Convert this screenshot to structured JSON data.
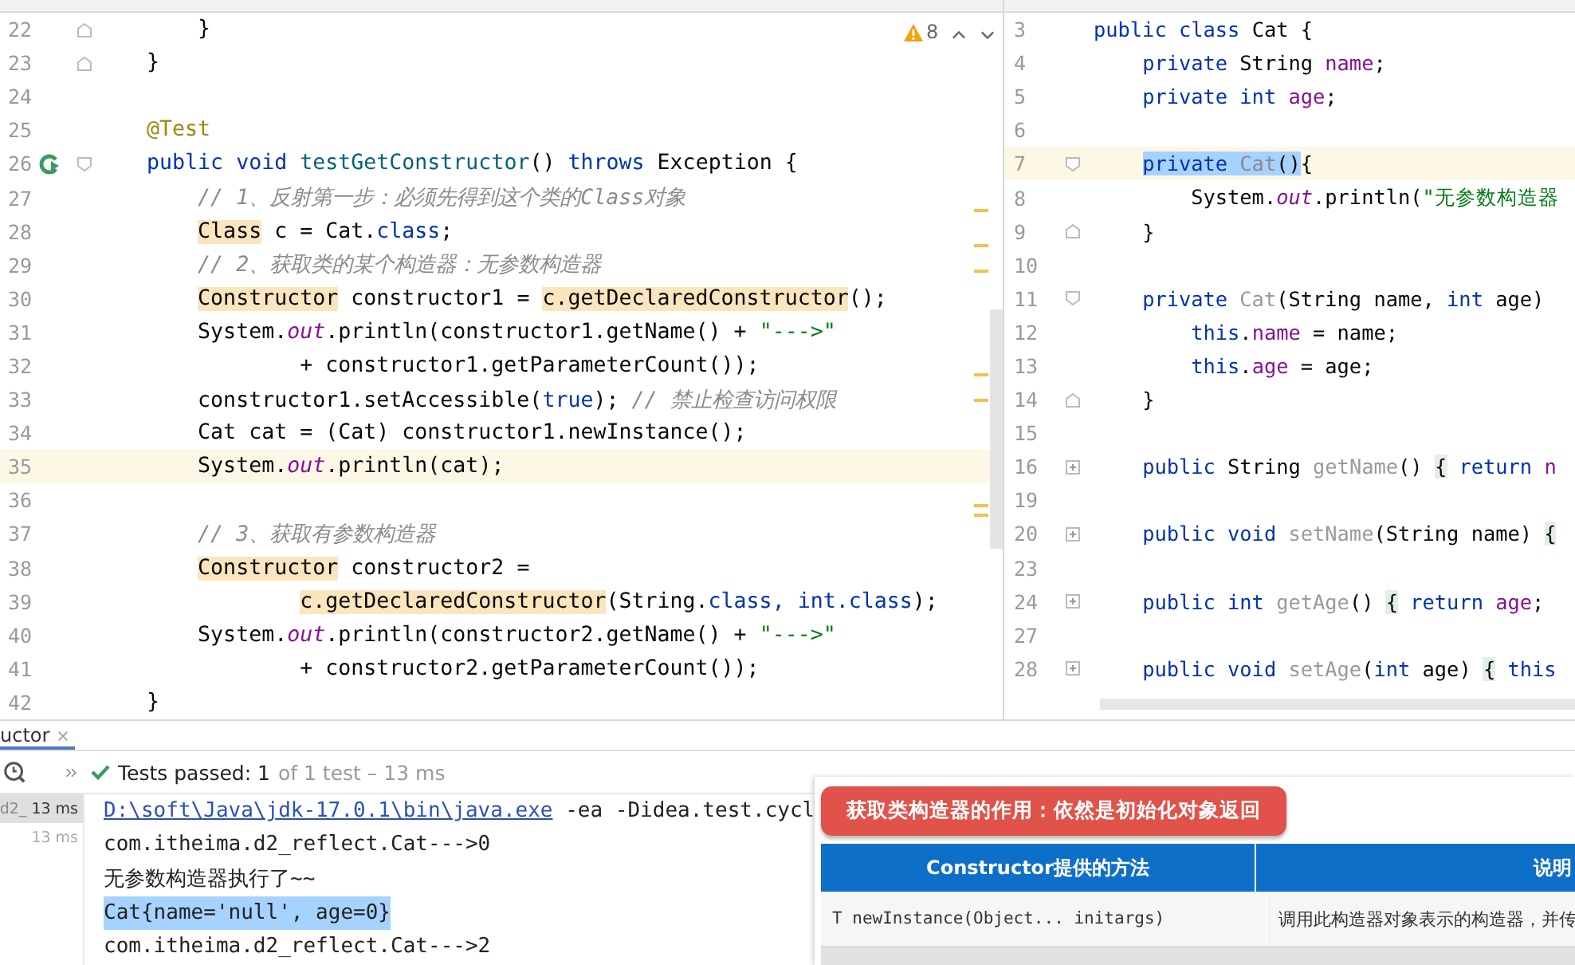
{
  "left_editor": {
    "warnings": "8",
    "lines": [
      {
        "no": "22",
        "current": false,
        "gutter": {
          "kind": "foldend"
        },
        "tokens": [
          {
            "kind": "p",
            "text": "        }"
          }
        ]
      },
      {
        "no": "23",
        "current": false,
        "gutter": {
          "kind": "foldend"
        },
        "tokens": [
          {
            "kind": "p",
            "text": "    }"
          }
        ]
      },
      {
        "no": "24",
        "current": false
      },
      {
        "no": "25",
        "current": false,
        "tokens": [
          {
            "kind": "a",
            "text": "    @Test"
          }
        ]
      },
      {
        "no": "26",
        "current": false,
        "gutter": {
          "kind": "run"
        },
        "tokens": [
          {
            "kind": "k",
            "text": "    public void "
          },
          {
            "kind": "m",
            "text": "testGetConstructor"
          },
          {
            "kind": "p",
            "text": "() "
          },
          {
            "kind": "k",
            "text": "throws "
          },
          {
            "kind": "p",
            "text": "Exception {"
          }
        ]
      },
      {
        "no": "27",
        "current": false,
        "tokens": [
          {
            "kind": "c",
            "text": "        // 1、反射第一步：必须先得到这个类的Class对象"
          }
        ]
      },
      {
        "no": "28",
        "current": false,
        "tokens": [
          {
            "kind": "h",
            "text": "        Class"
          },
          {
            "kind": "p",
            "text": " c = Cat."
          },
          {
            "kind": "k",
            "text": "class"
          },
          {
            "kind": "p",
            "text": ";"
          }
        ]
      },
      {
        "no": "29",
        "current": false,
        "tokens": [
          {
            "kind": "c",
            "text": "        // 2、获取类的某个构造器：无参数构造器"
          }
        ]
      },
      {
        "no": "30",
        "current": false,
        "tokens": [
          {
            "kind": "h",
            "text": "        Constructor"
          },
          {
            "kind": "p",
            "text": " constructor1 = "
          },
          {
            "kind": "h",
            "text": "c.getDeclaredConstructor"
          },
          {
            "kind": "p",
            "text": "();"
          }
        ]
      },
      {
        "no": "31",
        "current": false,
        "tokens": [
          {
            "kind": "p",
            "text": "        System."
          },
          {
            "kind": "f",
            "text": "out"
          },
          {
            "kind": "p",
            "text": ".println(constructor1.getName() + "
          },
          {
            "kind": "s",
            "text": "\"--->\""
          }
        ]
      },
      {
        "no": "32",
        "current": false,
        "tokens": [
          {
            "kind": "p",
            "text": "                + constructor1.getParameterCount());"
          }
        ]
      },
      {
        "no": "33",
        "current": false,
        "tokens": [
          {
            "kind": "p",
            "text": "        constructor1.setAccessible("
          },
          {
            "kind": "k",
            "text": "true"
          },
          {
            "kind": "p",
            "text": "); "
          },
          {
            "kind": "c",
            "text": "// 禁止检查访问权限"
          }
        ]
      },
      {
        "no": "34",
        "current": false,
        "tokens": [
          {
            "kind": "p",
            "text": "        Cat cat = (Cat) constructor1.newInstance();"
          }
        ]
      },
      {
        "no": "35",
        "current": true,
        "tokens": [
          {
            "kind": "p",
            "text": "        System."
          },
          {
            "kind": "f",
            "text": "out"
          },
          {
            "kind": "p",
            "text": ".println(cat);"
          }
        ]
      },
      {
        "no": "36",
        "current": false
      },
      {
        "no": "37",
        "current": false,
        "tokens": [
          {
            "kind": "c",
            "text": "        // 3、获取有参数构造器"
          }
        ]
      },
      {
        "no": "38",
        "current": false,
        "tokens": [
          {
            "kind": "h",
            "text": "        Constructor"
          },
          {
            "kind": "p",
            "text": " constructor2 ="
          }
        ]
      },
      {
        "no": "39",
        "current": false,
        "tokens": [
          {
            "kind": "h",
            "text": "                c.getDeclaredConstructor"
          },
          {
            "kind": "p",
            "text": "(String."
          },
          {
            "kind": "k",
            "text": "class"
          },
          {
            "kind": "k",
            "text": ", int.class"
          },
          {
            "kind": "p",
            "text": ");"
          }
        ]
      },
      {
        "no": "40",
        "current": false,
        "tokens": [
          {
            "kind": "p",
            "text": "        System."
          },
          {
            "kind": "f",
            "text": "out"
          },
          {
            "kind": "p",
            "text": ".println(constructor2.getName() + "
          },
          {
            "kind": "s",
            "text": "\"--->\""
          }
        ]
      },
      {
        "no": "41",
        "current": false,
        "tokens": [
          {
            "kind": "p",
            "text": "                + constructor2.getParameterCount());"
          }
        ]
      },
      {
        "no": "42",
        "current": false,
        "tokens": [
          {
            "kind": "p",
            "text": "    }"
          }
        ]
      }
    ]
  },
  "right_editor": {
    "lines": [
      {
        "no": "3",
        "current": false,
        "tokens": [
          {
            "kind": "k",
            "text": "public class "
          },
          {
            "kind": "p",
            "text": "Cat {"
          }
        ]
      },
      {
        "no": "4",
        "current": false,
        "tokens": [
          {
            "kind": "k",
            "text": "    private "
          },
          {
            "kind": "p",
            "text": "String "
          },
          {
            "kind": "v",
            "text": "name"
          },
          {
            "kind": "p",
            "text": ";"
          }
        ]
      },
      {
        "no": "5",
        "current": false,
        "tokens": [
          {
            "kind": "k",
            "text": "    private int "
          },
          {
            "kind": "v",
            "text": "age"
          },
          {
            "kind": "p",
            "text": ";"
          }
        ]
      },
      {
        "no": "6",
        "current": false
      },
      {
        "no": "7",
        "current": true,
        "gutter": {
          "kind": "fold"
        },
        "tokens": [
          {
            "kind": "xk",
            "text": "    private "
          },
          {
            "kind": "xg",
            "text": "Cat"
          },
          {
            "kind": "xp",
            "text": "()"
          },
          {
            "kind": "p",
            "text": "{"
          }
        ]
      },
      {
        "no": "8",
        "current": false,
        "tokens": [
          {
            "kind": "p",
            "text": "        System."
          },
          {
            "kind": "f",
            "text": "out"
          },
          {
            "kind": "p",
            "text": ".println("
          },
          {
            "kind": "s",
            "text": "\"无参数构造器"
          }
        ]
      },
      {
        "no": "9",
        "current": false,
        "gutter": {
          "kind": "foldend"
        },
        "tokens": [
          {
            "kind": "p",
            "text": "    }"
          }
        ]
      },
      {
        "no": "10",
        "current": false
      },
      {
        "no": "11",
        "current": false,
        "gutter": {
          "kind": "fold"
        },
        "tokens": [
          {
            "kind": "k",
            "text": "    private "
          },
          {
            "kind": "g",
            "text": "Cat"
          },
          {
            "kind": "p",
            "text": "(String name, "
          },
          {
            "kind": "k",
            "text": "int"
          },
          {
            "kind": "p",
            "text": " age)"
          }
        ]
      },
      {
        "no": "12",
        "current": false,
        "tokens": [
          {
            "kind": "k",
            "text": "        this"
          },
          {
            "kind": "p",
            "text": "."
          },
          {
            "kind": "v",
            "text": "name"
          },
          {
            "kind": "p",
            "text": " = name;"
          }
        ]
      },
      {
        "no": "13",
        "current": false,
        "tokens": [
          {
            "kind": "k",
            "text": "        this"
          },
          {
            "kind": "p",
            "text": "."
          },
          {
            "kind": "v",
            "text": "age"
          },
          {
            "kind": "p",
            "text": " = age;"
          }
        ]
      },
      {
        "no": "14",
        "current": false,
        "gutter": {
          "kind": "foldend"
        },
        "tokens": [
          {
            "kind": "p",
            "text": "    }"
          }
        ]
      },
      {
        "no": "15",
        "current": false
      },
      {
        "no": "16",
        "current": false,
        "gutter": {
          "kind": "plus"
        },
        "tokens": [
          {
            "kind": "k",
            "text": "    public "
          },
          {
            "kind": "p",
            "text": "String "
          },
          {
            "kind": "g",
            "text": "getName"
          },
          {
            "kind": "p",
            "text": "() "
          },
          {
            "kind": "b",
            "text": "{"
          },
          {
            "kind": "k",
            "text": " return "
          },
          {
            "kind": "v",
            "text": "n"
          }
        ]
      },
      {
        "no": "19",
        "current": false
      },
      {
        "no": "20",
        "current": false,
        "gutter": {
          "kind": "plus"
        },
        "tokens": [
          {
            "kind": "k",
            "text": "    public void "
          },
          {
            "kind": "g",
            "text": "setName"
          },
          {
            "kind": "p",
            "text": "(String name) "
          },
          {
            "kind": "b",
            "text": "{"
          }
        ]
      },
      {
        "no": "23",
        "current": false
      },
      {
        "no": "24",
        "current": false,
        "gutter": {
          "kind": "plus"
        },
        "tokens": [
          {
            "kind": "k",
            "text": "    public int "
          },
          {
            "kind": "g",
            "text": "getAge"
          },
          {
            "kind": "p",
            "text": "() "
          },
          {
            "kind": "b",
            "text": "{"
          },
          {
            "kind": "k",
            "text": " return "
          },
          {
            "kind": "v",
            "text": "age"
          },
          {
            "kind": "p",
            "text": ";"
          }
        ]
      },
      {
        "no": "27",
        "current": false
      },
      {
        "no": "28",
        "current": false,
        "gutter": {
          "kind": "plus"
        },
        "tokens": [
          {
            "kind": "k",
            "text": "    public void "
          },
          {
            "kind": "g",
            "text": "setAge"
          },
          {
            "kind": "p",
            "text": "("
          },
          {
            "kind": "k",
            "text": "int"
          },
          {
            "kind": "p",
            "text": " age) "
          },
          {
            "kind": "b",
            "text": "{"
          },
          {
            "kind": "k",
            "text": " this"
          }
        ]
      }
    ]
  },
  "run_panel": {
    "tab": "uctor",
    "status": "Tests passed: 1",
    "status_detail": "of 1 test – 13 ms",
    "tree": [
      {
        "label": "d2_",
        "time": "13 ms",
        "selected": true
      },
      {
        "time": "13 ms",
        "selected": false
      }
    ],
    "console": [
      {
        "link": "D:\\soft\\Java\\jdk-17.0.1\\bin\\java.exe",
        "text": " -ea -Didea.test.cycl",
        "selected": false
      },
      {
        "text": "com.itheima.d2_reflect.Cat--->0",
        "selected": false
      },
      {
        "text": "无参数构造器执行了~~",
        "selected": false
      },
      {
        "text": "Cat{name='null', age=0}",
        "selected": true
      },
      {
        "text": "com.itheima.d2_reflect.Cat--->2",
        "selected": false
      }
    ]
  },
  "slide": {
    "banner": "获取类构造器的作用：依然是初始化对象返回",
    "columns": [
      "Constructor提供的方法",
      "说明"
    ],
    "rows": [
      [
        "T newInstance(Object... initargs)",
        "调用此构造器对象表示的构造器，并传"
      ]
    ]
  }
}
